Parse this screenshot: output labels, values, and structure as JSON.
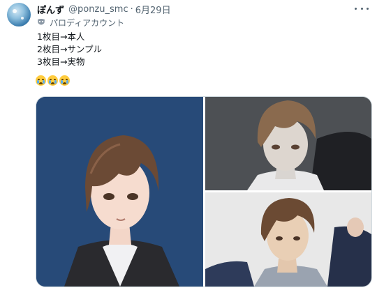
{
  "tweet": {
    "author": {
      "display_name": "ぽんず",
      "handle": "@ponzu_smc",
      "avatar_icon": "avatar-image"
    },
    "separator": "·",
    "date": "6月29日",
    "parody_label": "パロディアカウント",
    "lines": [
      "1枚目→本人",
      "2枚目→サンプル",
      "3枚目→実物"
    ],
    "emojis": [
      "loudly-crying-face",
      "loudly-crying-face",
      "loudly-crying-face"
    ],
    "media": [
      {
        "name": "illustration-image",
        "description_icon": "anime-character-illustration"
      },
      {
        "name": "sample-figure-image",
        "description_icon": "figure-photo"
      },
      {
        "name": "actual-figure-image",
        "description_icon": "figure-photo"
      }
    ]
  },
  "colors": {
    "text_primary": "#0f1419",
    "text_secondary": "#536471",
    "border": "#cfd9de",
    "illustration_bg": "#274a78"
  }
}
